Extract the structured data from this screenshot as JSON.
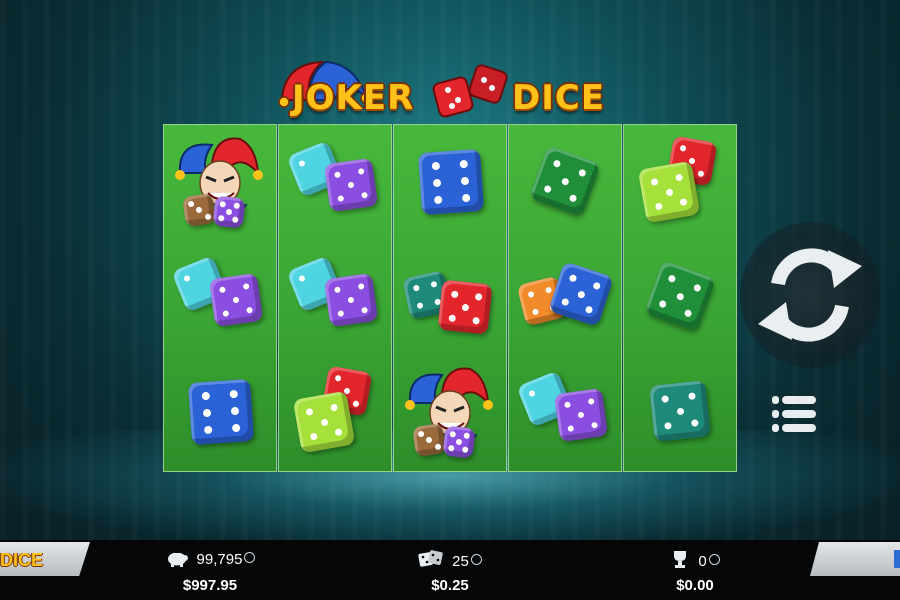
{
  "game": {
    "logo_part1": "JOKER",
    "logo_part2": "DICE",
    "left_tab_text": "DICE"
  },
  "reels": [
    [
      "joker",
      "cyan-purple-dice",
      "blue-die"
    ],
    [
      "cyan-purple-dice",
      "cyan-purple-dice",
      "lime-red-dice"
    ],
    [
      "blue-die",
      "teal-red-dice",
      "joker"
    ],
    [
      "green-die",
      "orange-blue-dice",
      "cyan-purple-dice"
    ],
    [
      "lime-red-dice",
      "green-die",
      "teal-die"
    ]
  ],
  "stats": {
    "balance_coins": "99,795",
    "balance_money": "$997.95",
    "bet_coins": "25",
    "bet_money": "$0.25",
    "win_coins": "0",
    "win_money": "$0.00"
  },
  "colors": {
    "reel_green": "#3aa534",
    "logo_gold": "#ffc21a",
    "die_red": "#e3262c",
    "die_blue": "#2b63d6",
    "die_cyan": "#4fd4e2",
    "die_purple": "#8a4fe0",
    "die_green": "#1f8f3a",
    "die_lime": "#a6e03a",
    "die_orange": "#f08a2a",
    "die_teal": "#1e8a7a"
  },
  "icons": {
    "spin": "refresh-icon",
    "menu": "menu-list-icon",
    "balance": "piggy-bank-icon",
    "bet": "dice-icon",
    "win": "trophy-icon"
  }
}
